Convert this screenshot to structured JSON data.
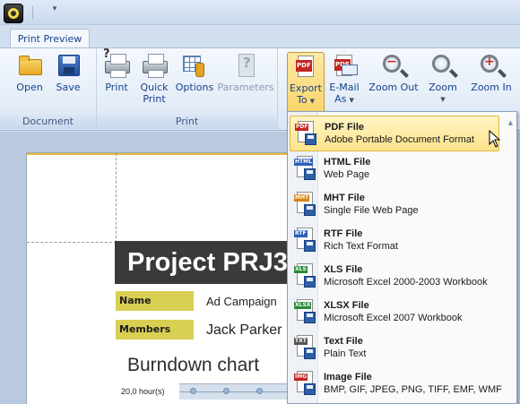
{
  "ribbon": {
    "tab_label": "Print Preview",
    "groups": {
      "document": "Document",
      "print": "Print"
    },
    "buttons": {
      "open": "Open",
      "save": "Save",
      "print": "Print",
      "quick_print_1": "Quick",
      "quick_print_2": "Print",
      "options": "Options",
      "parameters": "Parameters",
      "export_1": "Export",
      "export_2": "To",
      "email_1": "E-Mail",
      "email_2": "As",
      "zoom_out": "Zoom Out",
      "zoom": "Zoom",
      "zoom_in": "Zoom In"
    }
  },
  "document": {
    "project_title": "Project PRJ3",
    "fields": [
      {
        "label": "Name",
        "value": "Ad Campaign"
      },
      {
        "label": "Members",
        "value": "Jack Parker"
      }
    ],
    "chart_heading": "Burndown chart",
    "axis_value": "20,0 hour(s)"
  },
  "export_menu": {
    "items": [
      {
        "tag": "PDF",
        "tag_color": "#c2271f",
        "title": "PDF File",
        "subtitle": "Adobe Portable Document Format"
      },
      {
        "tag": "HTML",
        "tag_color": "#2f5fb5",
        "title": "HTML File",
        "subtitle": "Web Page"
      },
      {
        "tag": "MHT",
        "tag_color": "#d2851c",
        "title": "MHT File",
        "subtitle": "Single File Web Page"
      },
      {
        "tag": "RTF",
        "tag_color": "#2f5fb5",
        "title": "RTF File",
        "subtitle": "Rich Text Format"
      },
      {
        "tag": "XLS",
        "tag_color": "#2a8a3a",
        "title": "XLS File",
        "subtitle": "Microsoft Excel 2000-2003 Workbook"
      },
      {
        "tag": "XLSX",
        "tag_color": "#2a8a3a",
        "title": "XLSX File",
        "subtitle": "Microsoft Excel 2007 Workbook"
      },
      {
        "tag": "TXT",
        "tag_color": "#555555",
        "title": "Text File",
        "subtitle": "Plain Text"
      },
      {
        "tag": "IMG",
        "tag_color": "#c2271f",
        "title": "Image File",
        "subtitle": "BMP, GIF, JPEG, PNG, TIFF, EMF, WMF"
      }
    ]
  }
}
